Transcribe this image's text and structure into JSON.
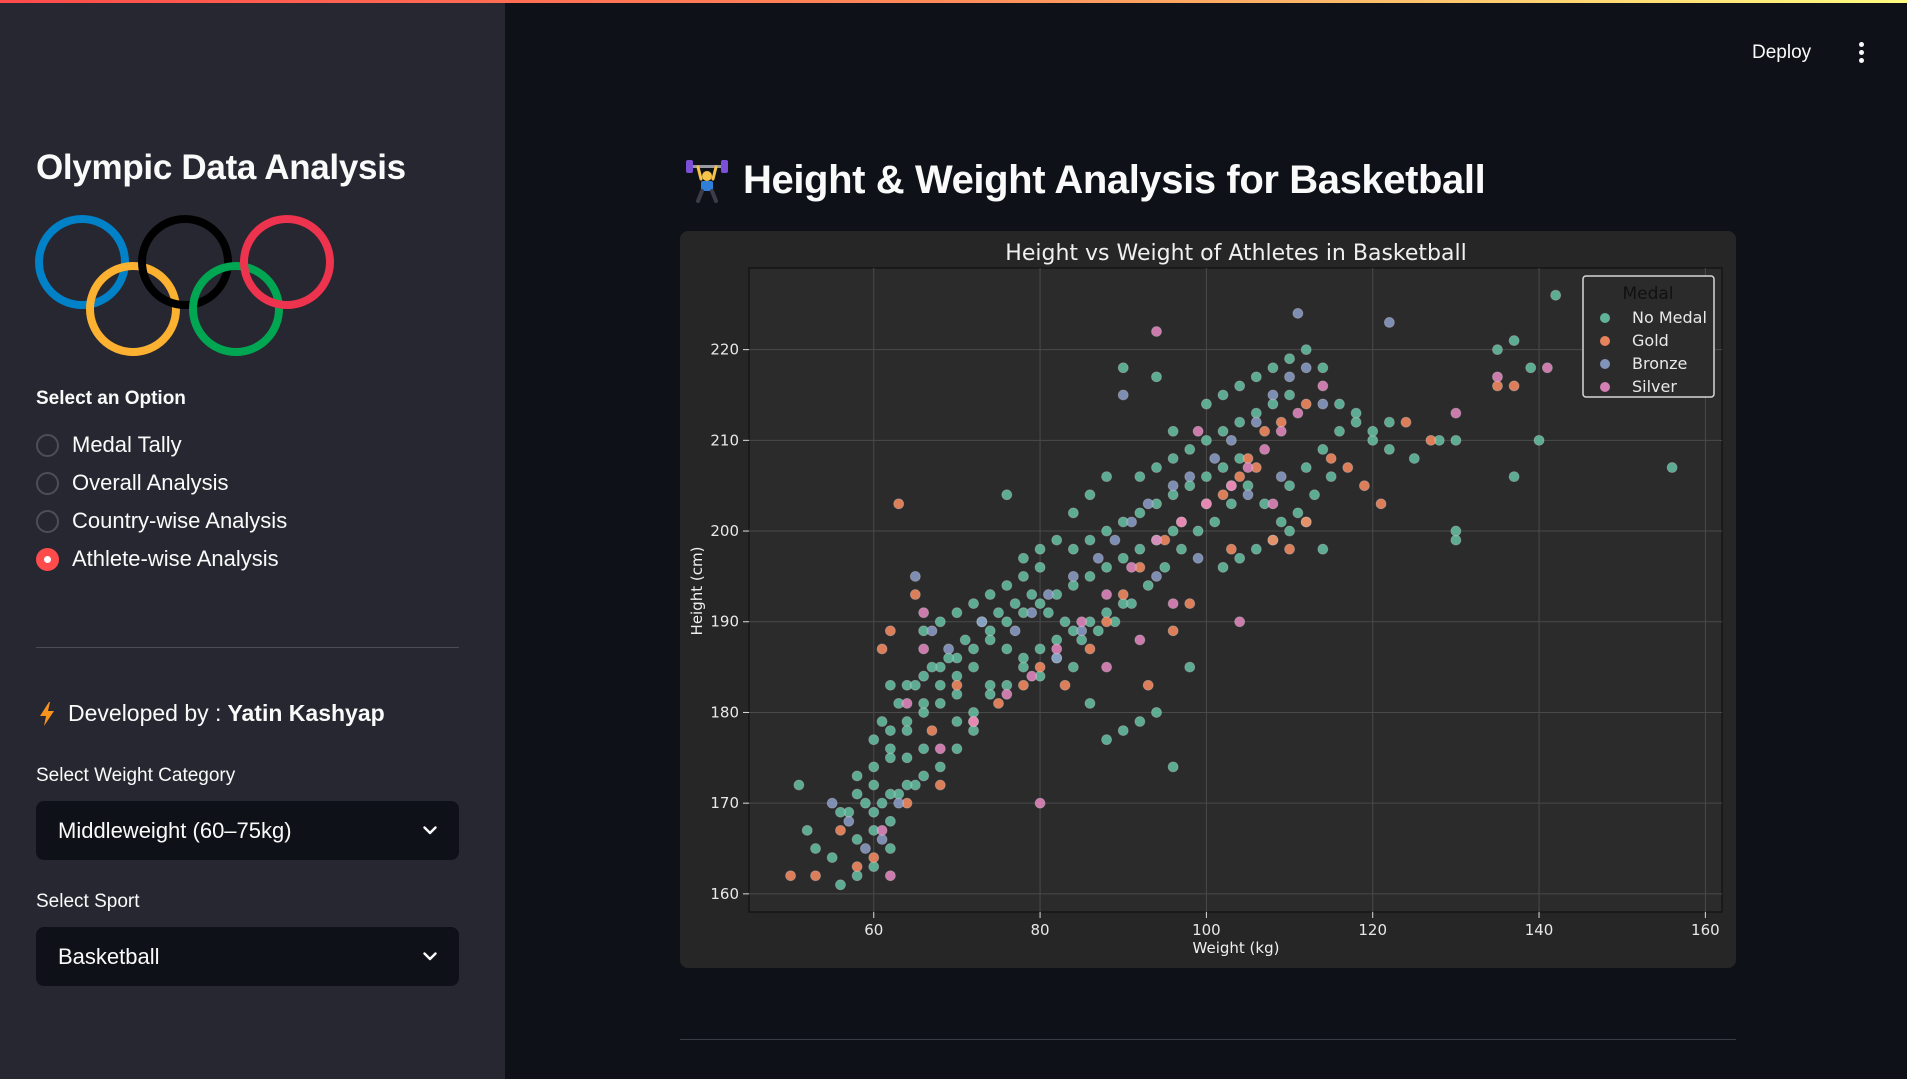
{
  "sidebar": {
    "title": "Olympic Data Analysis",
    "select_option_label": "Select an Option",
    "options": [
      {
        "label": "Medal Tally",
        "selected": false
      },
      {
        "label": "Overall Analysis",
        "selected": false
      },
      {
        "label": "Country-wise Analysis",
        "selected": false
      },
      {
        "label": "Athlete-wise Analysis",
        "selected": true
      }
    ],
    "developed_prefix": "Developed by :",
    "developer": "Yatin Kashyap",
    "weight_label": "Select Weight Category",
    "weight_value": "Middleweight (60–75kg)",
    "sport_label": "Select Sport",
    "sport_value": "Basketball",
    "ring_colors": [
      "#0081c8",
      "#fcb131",
      "#000000",
      "#00a651",
      "#ee334e"
    ]
  },
  "header": {
    "deploy_label": "Deploy",
    "menu_icon": "kebab-menu-icon"
  },
  "main": {
    "heading_icon": "weightlifter-emoji",
    "heading": "Height & Weight Analysis for Basketball"
  },
  "colors": {
    "accent": "#ff4b4b",
    "no_medal": "#66c2a5",
    "gold": "#fc8d62",
    "bronze": "#8da0cb",
    "silver": "#e78ac3"
  },
  "chart_data": {
    "type": "scatter",
    "title": "Height vs Weight of Athletes in Basketball",
    "xlabel": "Weight (kg)",
    "ylabel": "Height (cm)",
    "xlim": [
      45,
      162
    ],
    "ylim": [
      158,
      229
    ],
    "xticks": [
      60,
      80,
      100,
      120,
      140,
      160
    ],
    "yticks": [
      160,
      170,
      180,
      190,
      200,
      210,
      220
    ],
    "grid": true,
    "legend_title": "Medal",
    "legend_placement": "top-right",
    "series": [
      {
        "name": "No Medal",
        "color": "#66c2a5",
        "points": [
          [
            56,
            161
          ],
          [
            58,
            162
          ],
          [
            60,
            163
          ],
          [
            62,
            165
          ],
          [
            58,
            166
          ],
          [
            60,
            167
          ],
          [
            62,
            168
          ],
          [
            57,
            169
          ],
          [
            59,
            170
          ],
          [
            61,
            170
          ],
          [
            63,
            171
          ],
          [
            65,
            172
          ],
          [
            58,
            173
          ],
          [
            60,
            174
          ],
          [
            62,
            175
          ],
          [
            64,
            175
          ],
          [
            66,
            176
          ],
          [
            60,
            177
          ],
          [
            62,
            178
          ],
          [
            64,
            179
          ],
          [
            66,
            180
          ],
          [
            68,
            181
          ],
          [
            70,
            182
          ],
          [
            62,
            183
          ],
          [
            64,
            183
          ],
          [
            66,
            184
          ],
          [
            68,
            185
          ],
          [
            70,
            186
          ],
          [
            72,
            187
          ],
          [
            74,
            188
          ],
          [
            66,
            189
          ],
          [
            68,
            190
          ],
          [
            70,
            191
          ],
          [
            72,
            192
          ],
          [
            74,
            193
          ],
          [
            76,
            194
          ],
          [
            78,
            195
          ],
          [
            80,
            196
          ],
          [
            70,
            179
          ],
          [
            72,
            180
          ],
          [
            74,
            182
          ],
          [
            76,
            183
          ],
          [
            78,
            185
          ],
          [
            80,
            187
          ],
          [
            82,
            188
          ],
          [
            84,
            189
          ],
          [
            86,
            190
          ],
          [
            88,
            191
          ],
          [
            90,
            192
          ],
          [
            76,
            190
          ],
          [
            78,
            191
          ],
          [
            80,
            192
          ],
          [
            82,
            193
          ],
          [
            84,
            194
          ],
          [
            86,
            195
          ],
          [
            88,
            196
          ],
          [
            90,
            197
          ],
          [
            92,
            198
          ],
          [
            94,
            199
          ],
          [
            96,
            200
          ],
          [
            84,
            198
          ],
          [
            86,
            199
          ],
          [
            88,
            200
          ],
          [
            90,
            201
          ],
          [
            92,
            202
          ],
          [
            94,
            203
          ],
          [
            96,
            204
          ],
          [
            98,
            205
          ],
          [
            100,
            206
          ],
          [
            102,
            207
          ],
          [
            104,
            208
          ],
          [
            92,
            206
          ],
          [
            94,
            207
          ],
          [
            96,
            208
          ],
          [
            98,
            209
          ],
          [
            100,
            210
          ],
          [
            102,
            211
          ],
          [
            104,
            212
          ],
          [
            106,
            213
          ],
          [
            108,
            214
          ],
          [
            110,
            215
          ],
          [
            100,
            214
          ],
          [
            102,
            215
          ],
          [
            104,
            216
          ],
          [
            106,
            217
          ],
          [
            108,
            218
          ],
          [
            110,
            219
          ],
          [
            112,
            220
          ],
          [
            114,
            218
          ],
          [
            116,
            214
          ],
          [
            118,
            212
          ],
          [
            120,
            210
          ],
          [
            122,
            212
          ],
          [
            125,
            208
          ],
          [
            128,
            210
          ],
          [
            130,
            210
          ],
          [
            135,
            220
          ],
          [
            137,
            221
          ],
          [
            139,
            218
          ],
          [
            140,
            210
          ],
          [
            137,
            206
          ],
          [
            130,
            199
          ],
          [
            130,
            200
          ],
          [
            156,
            207
          ],
          [
            142,
            226
          ],
          [
            90,
            218
          ],
          [
            94,
            217
          ],
          [
            96,
            211
          ],
          [
            88,
            206
          ],
          [
            86,
            204
          ],
          [
            84,
            202
          ],
          [
            82,
            199
          ],
          [
            80,
            198
          ],
          [
            78,
            197
          ],
          [
            76,
            204
          ],
          [
            74,
            189
          ],
          [
            72,
            185
          ],
          [
            70,
            184
          ],
          [
            68,
            183
          ],
          [
            66,
            181
          ],
          [
            64,
            178
          ],
          [
            62,
            176
          ],
          [
            60,
            172
          ],
          [
            58,
            171
          ],
          [
            56,
            169
          ],
          [
            52,
            167
          ],
          [
            53,
            165
          ],
          [
            55,
            164
          ],
          [
            51,
            172
          ],
          [
            98,
            185
          ],
          [
            96,
            174
          ],
          [
            94,
            180
          ],
          [
            92,
            179
          ],
          [
            90,
            178
          ],
          [
            88,
            177
          ],
          [
            86,
            181
          ],
          [
            84,
            185
          ],
          [
            82,
            186
          ],
          [
            80,
            184
          ],
          [
            78,
            186
          ],
          [
            76,
            187
          ],
          [
            74,
            183
          ],
          [
            72,
            178
          ],
          [
            70,
            176
          ],
          [
            68,
            174
          ],
          [
            66,
            173
          ],
          [
            64,
            172
          ],
          [
            62,
            171
          ],
          [
            60,
            169
          ],
          [
            102,
            196
          ],
          [
            104,
            197
          ],
          [
            106,
            198
          ],
          [
            108,
            199
          ],
          [
            110,
            200
          ],
          [
            112,
            201
          ],
          [
            114,
            198
          ],
          [
            110,
            205
          ],
          [
            112,
            207
          ],
          [
            114,
            209
          ],
          [
            116,
            211
          ],
          [
            118,
            213
          ],
          [
            120,
            211
          ],
          [
            122,
            209
          ],
          [
            115,
            206
          ],
          [
            113,
            204
          ],
          [
            111,
            202
          ],
          [
            109,
            201
          ],
          [
            107,
            203
          ],
          [
            105,
            205
          ],
          [
            103,
            203
          ],
          [
            101,
            201
          ],
          [
            99,
            200
          ],
          [
            97,
            198
          ],
          [
            95,
            196
          ],
          [
            93,
            194
          ],
          [
            91,
            192
          ],
          [
            89,
            190
          ],
          [
            87,
            189
          ],
          [
            85,
            188
          ],
          [
            83,
            190
          ],
          [
            81,
            191
          ],
          [
            79,
            193
          ],
          [
            77,
            192
          ],
          [
            75,
            191
          ],
          [
            73,
            190
          ],
          [
            71,
            188
          ],
          [
            69,
            186
          ],
          [
            67,
            185
          ],
          [
            65,
            183
          ],
          [
            63,
            181
          ],
          [
            61,
            179
          ]
        ]
      },
      {
        "name": "Gold",
        "color": "#fc8d62",
        "points": [
          [
            50,
            162
          ],
          [
            53,
            162
          ],
          [
            58,
            163
          ],
          [
            63,
            203
          ],
          [
            65,
            193
          ],
          [
            62,
            189
          ],
          [
            61,
            187
          ],
          [
            67,
            178
          ],
          [
            70,
            183
          ],
          [
            72,
            179
          ],
          [
            75,
            181
          ],
          [
            78,
            183
          ],
          [
            80,
            185
          ],
          [
            83,
            183
          ],
          [
            86,
            187
          ],
          [
            88,
            190
          ],
          [
            90,
            193
          ],
          [
            92,
            196
          ],
          [
            95,
            199
          ],
          [
            97,
            201
          ],
          [
            100,
            203
          ],
          [
            103,
            205
          ],
          [
            105,
            208
          ],
          [
            107,
            211
          ],
          [
            109,
            212
          ],
          [
            112,
            214
          ],
          [
            115,
            208
          ],
          [
            117,
            207
          ],
          [
            119,
            205
          ],
          [
            121,
            203
          ],
          [
            124,
            212
          ],
          [
            127,
            210
          ],
          [
            135,
            216
          ],
          [
            137,
            216
          ],
          [
            93,
            183
          ],
          [
            96,
            189
          ],
          [
            98,
            192
          ],
          [
            103,
            198
          ],
          [
            108,
            199
          ],
          [
            110,
            198
          ],
          [
            112,
            201
          ],
          [
            106,
            207
          ],
          [
            104,
            206
          ],
          [
            102,
            204
          ],
          [
            68,
            172
          ],
          [
            64,
            170
          ],
          [
            60,
            164
          ],
          [
            56,
            167
          ]
        ]
      },
      {
        "name": "Bronze",
        "color": "#8da0cb",
        "points": [
          [
            59,
            165
          ],
          [
            61,
            166
          ],
          [
            63,
            170
          ],
          [
            65,
            195
          ],
          [
            67,
            189
          ],
          [
            69,
            187
          ],
          [
            73,
            190
          ],
          [
            77,
            189
          ],
          [
            79,
            191
          ],
          [
            81,
            193
          ],
          [
            84,
            195
          ],
          [
            87,
            197
          ],
          [
            89,
            199
          ],
          [
            91,
            201
          ],
          [
            93,
            203
          ],
          [
            96,
            205
          ],
          [
            98,
            206
          ],
          [
            101,
            208
          ],
          [
            103,
            210
          ],
          [
            106,
            212
          ],
          [
            108,
            215
          ],
          [
            110,
            217
          ],
          [
            112,
            218
          ],
          [
            114,
            214
          ],
          [
            90,
            215
          ],
          [
            111,
            224
          ],
          [
            122,
            223
          ],
          [
            55,
            170
          ],
          [
            57,
            168
          ],
          [
            82,
            186
          ],
          [
            85,
            189
          ],
          [
            94,
            195
          ],
          [
            99,
            197
          ],
          [
            105,
            204
          ],
          [
            109,
            206
          ]
        ]
      },
      {
        "name": "Silver",
        "color": "#e78ac3",
        "points": [
          [
            62,
            162
          ],
          [
            66,
            187
          ],
          [
            64,
            181
          ],
          [
            61,
            167
          ],
          [
            66,
            191
          ],
          [
            68,
            176
          ],
          [
            72,
            179
          ],
          [
            76,
            182
          ],
          [
            79,
            184
          ],
          [
            82,
            187
          ],
          [
            85,
            190
          ],
          [
            88,
            193
          ],
          [
            91,
            196
          ],
          [
            94,
            199
          ],
          [
            97,
            201
          ],
          [
            100,
            203
          ],
          [
            103,
            205
          ],
          [
            105,
            207
          ],
          [
            107,
            209
          ],
          [
            109,
            211
          ],
          [
            111,
            213
          ],
          [
            114,
            216
          ],
          [
            80,
            170
          ],
          [
            94,
            222
          ],
          [
            130,
            213
          ],
          [
            135,
            217
          ],
          [
            141,
            218
          ],
          [
            88,
            185
          ],
          [
            92,
            188
          ],
          [
            96,
            192
          ],
          [
            104,
            190
          ],
          [
            108,
            203
          ],
          [
            99,
            211
          ]
        ]
      }
    ]
  }
}
